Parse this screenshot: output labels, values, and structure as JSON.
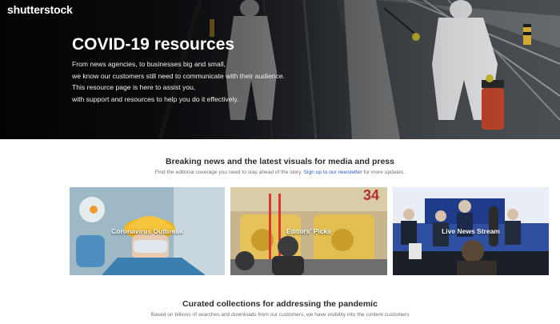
{
  "brand": {
    "logo": "shutterstock"
  },
  "hero": {
    "title": "COVID-19 resources",
    "lines": [
      "From news agencies, to businesses big and small,",
      "we know our customers still need to communicate with their audience.",
      "This resource page is here to assist you,",
      "with support and resources to help you do it effectively."
    ]
  },
  "breaking": {
    "title": "Breaking news and the latest visuals for media and press",
    "subtitle_pre": "Find the editorial coverage you need to stay ahead of the story.",
    "subtitle_link": "Sign up to our newsletter",
    "subtitle_post": "for more updates.",
    "cards": [
      {
        "label": "Coronavirus Outbreak"
      },
      {
        "label": "Editors' Picks",
        "sign_number": "34"
      },
      {
        "label": "Live News Stream"
      }
    ]
  },
  "curated": {
    "title": "Curated collections for addressing the pandemic",
    "subtitle": "Based on billions of searches and downloads from our customers, we have visibility into the content customers"
  },
  "colors": {
    "link": "#2d5bd6",
    "accent_orange": "#f2a23a"
  }
}
